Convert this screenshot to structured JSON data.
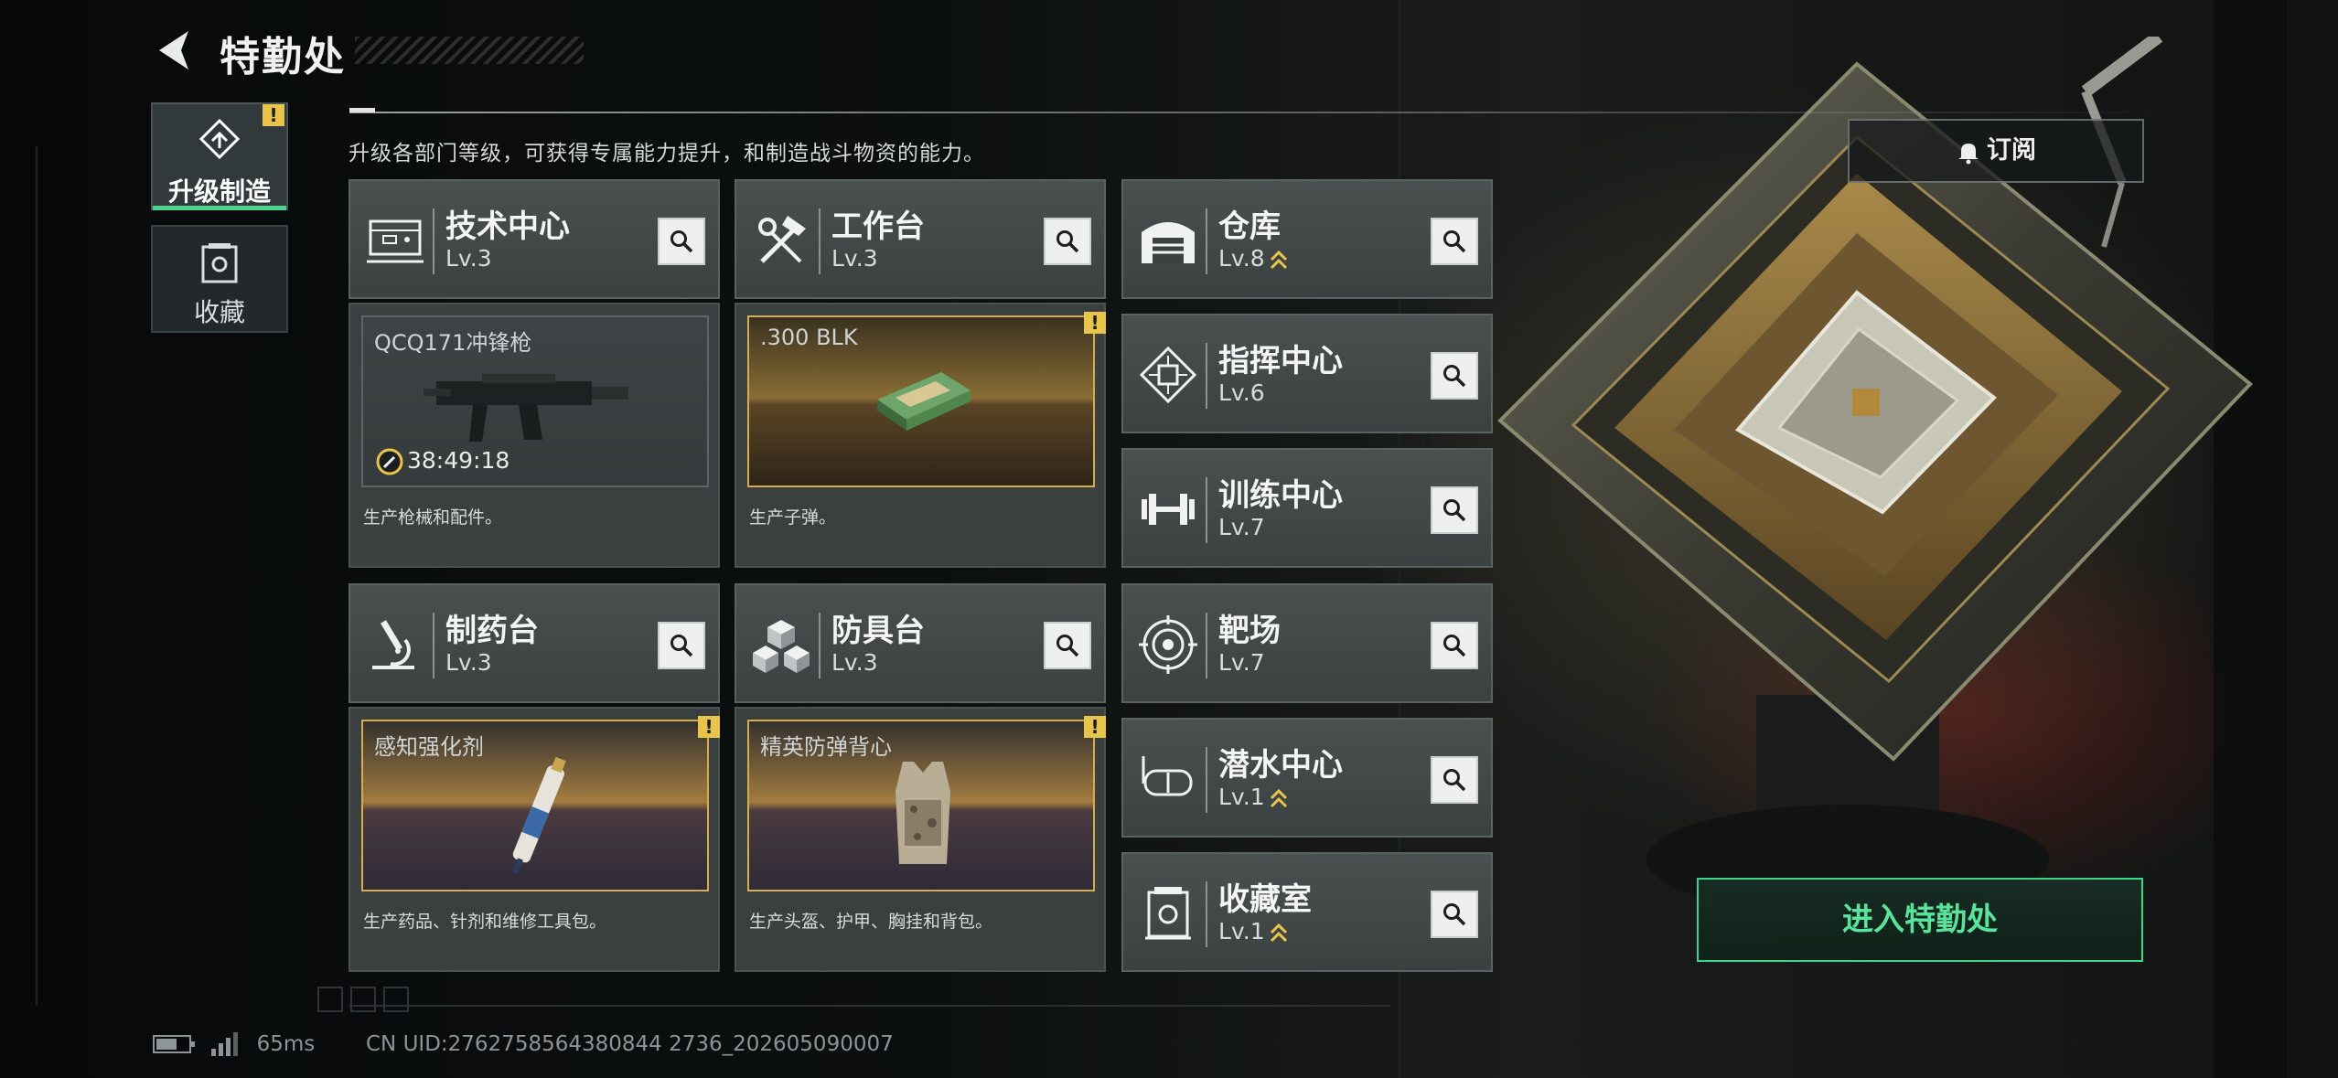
{
  "header": {
    "title": "特勤处"
  },
  "sidebar": {
    "tabs": [
      {
        "label": "升级制造",
        "active": true,
        "alert": "!"
      },
      {
        "label": "收藏",
        "active": false
      }
    ]
  },
  "description": "升级各部门等级，可获得专属能力提升，和制造战斗物资的能力。",
  "subscribe": {
    "label": "订阅",
    "icon": "bell-icon"
  },
  "enter_button": {
    "label": "进入特勤处"
  },
  "departments": [
    {
      "name": "技术中心",
      "level": "Lv.3",
      "icon": "computer-icon"
    },
    {
      "name": "工作台",
      "level": "Lv.3",
      "icon": "tools-icon"
    },
    {
      "name": "制药台",
      "level": "Lv.3",
      "icon": "microscope-icon"
    },
    {
      "name": "防具台",
      "level": "Lv.3",
      "icon": "blocks-icon"
    }
  ],
  "productions": [
    {
      "title": "QCQ171冲锋枪",
      "timer": "38:49:18",
      "desc": "生产枪械和配件。",
      "state": "in-progress"
    },
    {
      "title": ".300 BLK",
      "desc": "生产子弹。",
      "alert": "!",
      "state": "ready"
    },
    {
      "title": "感知强化剂",
      "desc": "生产药品、针剂和维修工具包。",
      "alert": "!",
      "state": "ready"
    },
    {
      "title": "精英防弹背心",
      "desc": "生产头盔、护甲、胸挂和背包。",
      "alert": "!",
      "state": "ready"
    }
  ],
  "facilities": [
    {
      "name": "仓库",
      "level": "Lv.8",
      "upgradable": true,
      "icon": "warehouse-icon"
    },
    {
      "name": "指挥中心",
      "level": "Lv.6",
      "upgradable": false,
      "icon": "chip-icon"
    },
    {
      "name": "训练中心",
      "level": "Lv.7",
      "upgradable": false,
      "icon": "dumbbell-icon"
    },
    {
      "name": "靶场",
      "level": "Lv.7",
      "upgradable": false,
      "icon": "target-icon"
    },
    {
      "name": "潜水中心",
      "level": "Lv.1",
      "upgradable": true,
      "icon": "diving-mask-icon"
    },
    {
      "name": "收藏室",
      "level": "Lv.1",
      "upgradable": true,
      "icon": "collection-icon"
    }
  ],
  "status": {
    "ping": "65ms",
    "uid": "CN UID:2762758564380844 2736_202605090007"
  },
  "colors": {
    "accent_green": "#4cd48e",
    "alert_yellow": "#e8c44a",
    "gold_border": "#d7ac4a"
  }
}
